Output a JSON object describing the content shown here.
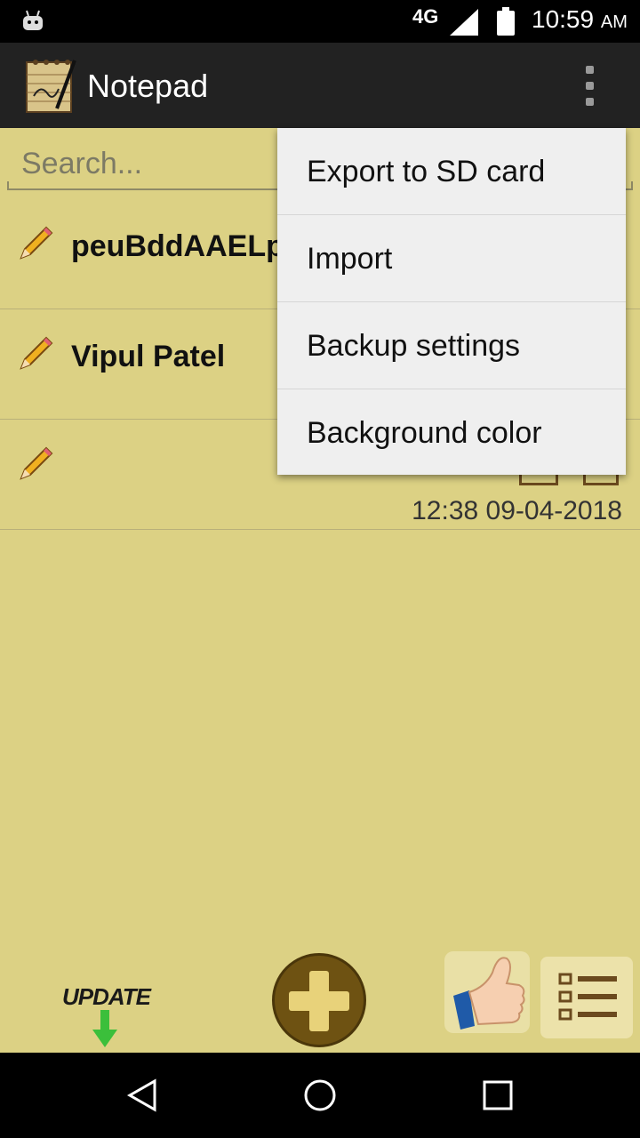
{
  "status_bar": {
    "network": "4G",
    "time": "10:59",
    "ampm": "AM"
  },
  "app_bar": {
    "title": "Notepad"
  },
  "search": {
    "placeholder": "Search..."
  },
  "notes": [
    {
      "title": "peuBddAAELpY",
      "timestamp": ""
    },
    {
      "title": "Vipul Patel",
      "timestamp": ""
    },
    {
      "title": "",
      "timestamp": "12:38 09-04-2018"
    }
  ],
  "toolbar": {
    "update_label": "UPDATE"
  },
  "menu": {
    "items": [
      {
        "label": "Export to SD card"
      },
      {
        "label": "Import"
      },
      {
        "label": "Backup settings"
      },
      {
        "label": "Background color"
      }
    ]
  },
  "colors": {
    "background": "#dcd184",
    "app_bar": "#222222",
    "menu": "#efefef",
    "accent_brown": "#6e5212"
  }
}
